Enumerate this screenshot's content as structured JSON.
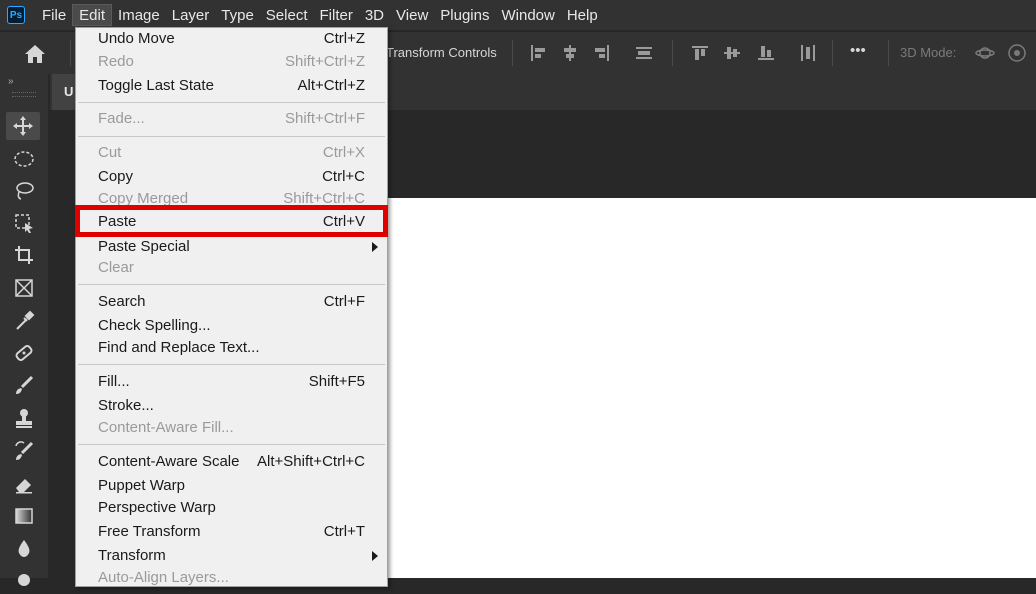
{
  "app": {
    "logo_text": "Ps"
  },
  "menubar": {
    "items": [
      {
        "label": "File"
      },
      {
        "label": "Edit"
      },
      {
        "label": "Image"
      },
      {
        "label": "Layer"
      },
      {
        "label": "Type"
      },
      {
        "label": "Select"
      },
      {
        "label": "Filter"
      },
      {
        "label": "3D"
      },
      {
        "label": "View"
      },
      {
        "label": "Plugins"
      },
      {
        "label": "Window"
      },
      {
        "label": "Help"
      }
    ]
  },
  "options": {
    "transform_controls": "Transform Controls",
    "three_d_mode": "3D Mode:",
    "more_label": "•••"
  },
  "document": {
    "tab_label": "U"
  },
  "edit_menu": {
    "items": [
      {
        "label": "Undo Move",
        "shortcut": "Ctrl+Z",
        "disabled": false
      },
      {
        "label": "Redo",
        "shortcut": "Shift+Ctrl+Z",
        "disabled": true
      },
      {
        "label": "Toggle Last State",
        "shortcut": "Alt+Ctrl+Z",
        "disabled": false
      },
      {
        "label": "Fade...",
        "shortcut": "Shift+Ctrl+F",
        "disabled": true
      },
      {
        "label": "Cut",
        "shortcut": "Ctrl+X",
        "disabled": true
      },
      {
        "label": "Copy",
        "shortcut": "Ctrl+C",
        "disabled": false
      },
      {
        "label": "Copy Merged",
        "shortcut": "Shift+Ctrl+C",
        "disabled": true
      },
      {
        "label": "Paste",
        "shortcut": "Ctrl+V",
        "disabled": false
      },
      {
        "label": "Paste Special",
        "shortcut": "",
        "disabled": false
      },
      {
        "label": "Clear",
        "shortcut": "",
        "disabled": true
      },
      {
        "label": "Search",
        "shortcut": "Ctrl+F",
        "disabled": false
      },
      {
        "label": "Check Spelling...",
        "shortcut": "",
        "disabled": false
      },
      {
        "label": "Find and Replace Text...",
        "shortcut": "",
        "disabled": false
      },
      {
        "label": "Fill...",
        "shortcut": "Shift+F5",
        "disabled": false
      },
      {
        "label": "Stroke...",
        "shortcut": "",
        "disabled": false
      },
      {
        "label": "Content-Aware Fill...",
        "shortcut": "",
        "disabled": true
      },
      {
        "label": "Content-Aware Scale",
        "shortcut": "Alt+Shift+Ctrl+C",
        "disabled": false
      },
      {
        "label": "Puppet Warp",
        "shortcut": "",
        "disabled": false
      },
      {
        "label": "Perspective Warp",
        "shortcut": "",
        "disabled": false
      },
      {
        "label": "Free Transform",
        "shortcut": "Ctrl+T",
        "disabled": false
      },
      {
        "label": "Transform",
        "shortcut": "",
        "disabled": false
      },
      {
        "label": "Auto-Align Layers...",
        "shortcut": "",
        "disabled": true
      }
    ]
  },
  "colors": {
    "highlight": "#e00000",
    "menu_bg": "#f0f0f0",
    "app_bg": "#323232"
  },
  "toolbar": {
    "tools": [
      {
        "icon": "move-icon"
      },
      {
        "icon": "elliptical-marquee-icon"
      },
      {
        "icon": "lasso-icon"
      },
      {
        "icon": "object-selection-icon"
      },
      {
        "icon": "crop-icon"
      },
      {
        "icon": "frame-icon"
      },
      {
        "icon": "eyedropper-icon"
      },
      {
        "icon": "healing-brush-icon"
      },
      {
        "icon": "brush-icon"
      },
      {
        "icon": "clone-stamp-icon"
      },
      {
        "icon": "history-brush-icon"
      },
      {
        "icon": "eraser-icon"
      },
      {
        "icon": "gradient-icon"
      },
      {
        "icon": "blur-icon"
      },
      {
        "icon": "dodge-icon"
      }
    ]
  }
}
